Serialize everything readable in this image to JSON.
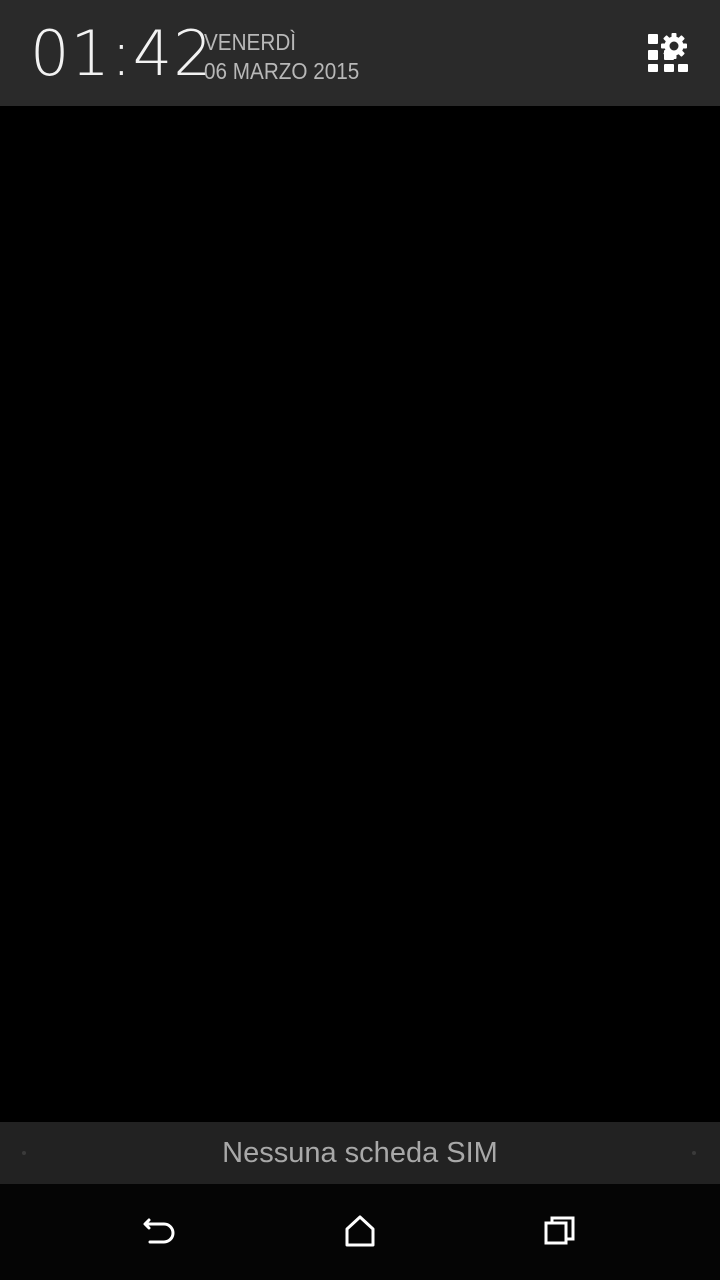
{
  "header": {
    "time": "01:42",
    "day": "VENERDÌ",
    "date": "06 MARZO 2015",
    "settings_icon": "quick-settings-grid-gear-icon"
  },
  "sim_status": {
    "text": "Nessuna scheda SIM"
  },
  "nav": {
    "back_icon": "back-icon",
    "home_icon": "home-icon",
    "recents_icon": "recents-icon"
  },
  "colors": {
    "header_bg": "#2a2a2a",
    "screen_bg": "#000000",
    "sim_bar_bg": "#222222",
    "nav_bg": "#050505",
    "clock_text": "#f2f2f2",
    "date_text": "#b8b8b8",
    "sim_text": "#a8a8a8"
  }
}
